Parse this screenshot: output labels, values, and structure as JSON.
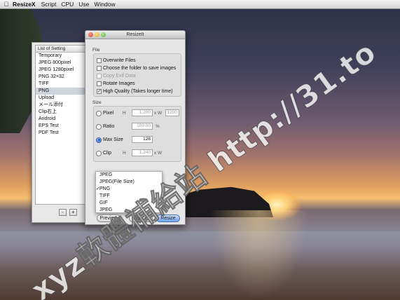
{
  "menubar": {
    "apple": "",
    "app_name": "ResizeX",
    "items": [
      "Script",
      "CPU",
      "Use",
      "Window"
    ]
  },
  "settings_window": {
    "header": "List of Setting",
    "items": [
      "Temporary",
      "JPEG 800pixel",
      "JPEG 1280pixel",
      "PNG 32×32",
      "TIFF",
      "PNG",
      "Upload",
      "メール添付",
      "Clip右上",
      "Android",
      "EPS Test",
      "PDF Test"
    ],
    "selected_index": 5,
    "remove_label": "-",
    "add_label": "+"
  },
  "resize_window": {
    "title": "ResizeIt",
    "file_section_label": "File",
    "checkboxes": [
      {
        "label": "Overwrite Files",
        "checked": false,
        "enabled": true
      },
      {
        "label": "Choose the folder to save images",
        "checked": false,
        "enabled": true
      },
      {
        "label": "Copy Exif Data",
        "checked": false,
        "enabled": false
      },
      {
        "label": "Rotate Images",
        "checked": false,
        "enabled": true
      },
      {
        "label": "High Quality (Takes longer time)",
        "checked": true,
        "enabled": true
      }
    ],
    "size_section_label": "Size",
    "size_options": {
      "pixel": {
        "label": "Pixel",
        "h_label": "H",
        "h_value": "1,200",
        "x_label": "x W",
        "w_value": "1200"
      },
      "ratio": {
        "label": "Ratio",
        "value": "100.00",
        "unit": "%"
      },
      "max_size": {
        "label": "Max Size",
        "value": "128",
        "selected": true
      },
      "clip": {
        "label": "Clip",
        "h_label": "H",
        "h_value": "1,240",
        "x_label": "x W"
      }
    },
    "format_menu": {
      "items": [
        "JPEG",
        "JPEG(File Size)",
        "PNG",
        "TIFF",
        "GIF",
        "JPEG"
      ],
      "checked_index": 2
    },
    "buttons": {
      "preview": "Preview",
      "cancel": "Cancel",
      "resize": "Resize"
    }
  },
  "watermark": "xyz軟體補給站 http://31.to"
}
